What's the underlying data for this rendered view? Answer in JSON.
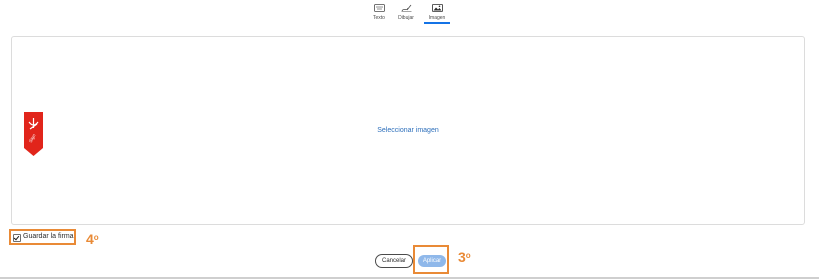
{
  "tabs": [
    {
      "label": "Texto",
      "icon": "keyboard-icon",
      "active": false
    },
    {
      "label": "Dibujar",
      "icon": "pen-draw-icon",
      "active": false
    },
    {
      "label": "Imagen",
      "icon": "image-icon",
      "active": true
    }
  ],
  "panel": {
    "select_image_label": "Seleccionar imagen",
    "badge_icon": "adobe-pdf-bookmark-icon",
    "badge_text": "Sign"
  },
  "footer": {
    "save_signature_label": "Guardar la firma",
    "save_signature_checked": true,
    "cancel_label": "Cancelar",
    "apply_label": "Aplicar"
  },
  "annotations": {
    "step_4_number": "4",
    "step_4_suffix": "o",
    "step_3_number": "3",
    "step_3_suffix": "o"
  },
  "colors": {
    "accent_blue": "#1473e6",
    "link_blue": "#2d6fbb",
    "highlight_orange": "#e98a36",
    "apply_disabled": "#8fb8ea",
    "pdf_red": "#e1251b"
  }
}
